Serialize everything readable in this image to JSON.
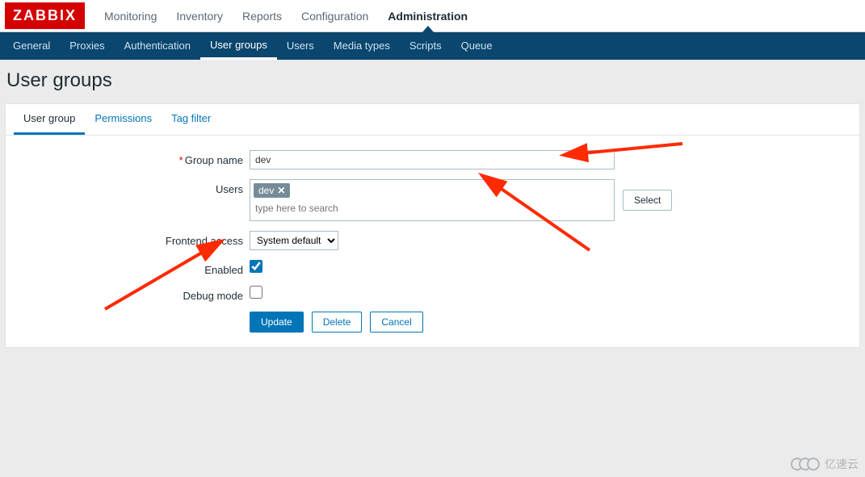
{
  "logo": "ZABBIX",
  "topnav": {
    "items": [
      "Monitoring",
      "Inventory",
      "Reports",
      "Configuration",
      "Administration"
    ],
    "active": 4
  },
  "subnav": {
    "items": [
      "General",
      "Proxies",
      "Authentication",
      "User groups",
      "Users",
      "Media types",
      "Scripts",
      "Queue"
    ],
    "active": 3
  },
  "page_title": "User groups",
  "tabs": {
    "items": [
      "User group",
      "Permissions",
      "Tag filter"
    ],
    "active": 0
  },
  "form": {
    "labels": {
      "group_name": "Group name",
      "users": "Users",
      "frontend_access": "Frontend access",
      "enabled": "Enabled",
      "debug_mode": "Debug mode"
    },
    "group_name_value": "dev",
    "user_tag": "dev",
    "users_placeholder": "type here to search",
    "select_button": "Select",
    "frontend_access_value": "System default",
    "enabled_checked": true,
    "debug_checked": false
  },
  "buttons": {
    "update": "Update",
    "delete": "Delete",
    "cancel": "Cancel"
  },
  "watermark": "亿速云"
}
